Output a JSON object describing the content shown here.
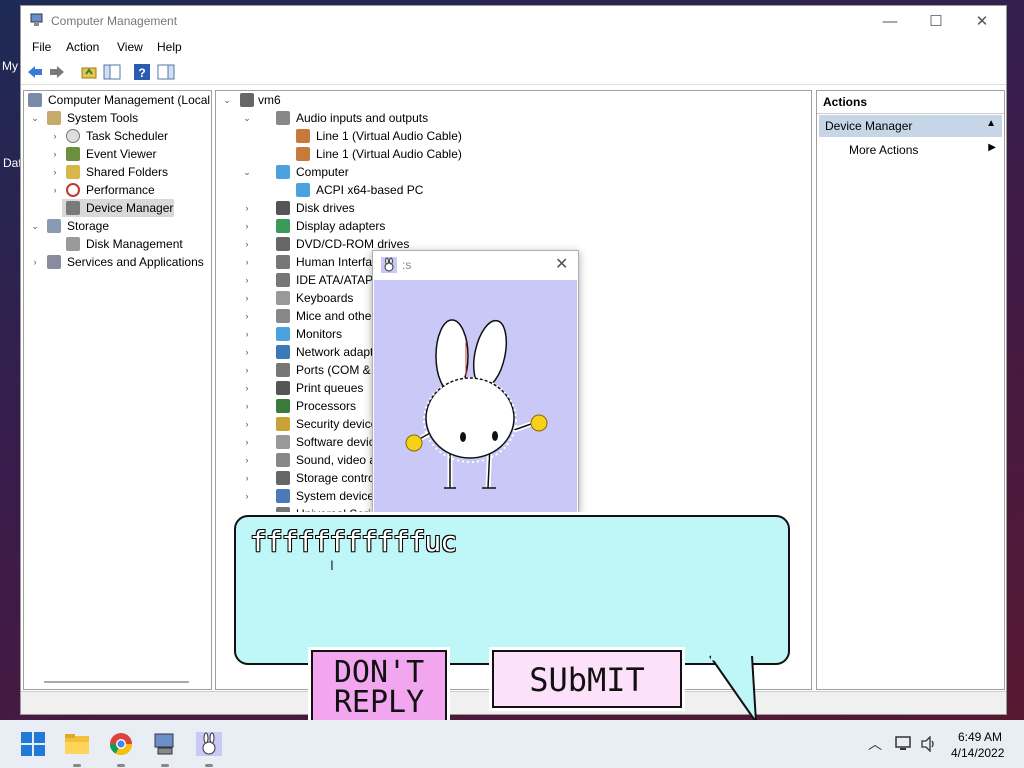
{
  "desktop": {
    "labels": [
      "My",
      "Dat"
    ]
  },
  "window": {
    "title": "Computer Management",
    "controls": {
      "minimize": "—",
      "maximize": "☐",
      "close": "✕"
    }
  },
  "menu": [
    "File",
    "Action",
    "View",
    "Help"
  ],
  "left_tree": {
    "root": "Computer Management (Local",
    "system_tools": "System Tools",
    "task_scheduler": "Task Scheduler",
    "event_viewer": "Event Viewer",
    "shared_folders": "Shared Folders",
    "performance": "Performance",
    "device_manager": "Device Manager",
    "storage": "Storage",
    "disk_management": "Disk Management",
    "services": "Services and Applications"
  },
  "device_tree": {
    "root": "vm6",
    "items": [
      "Audio inputs and outputs",
      "Line 1 (Virtual Audio Cable)",
      "Line 1 (Virtual Audio Cable)",
      "Computer",
      "ACPI x64-based PC",
      "Disk drives",
      "Display adapters",
      "DVD/CD-ROM drives",
      "Human Interface D",
      "IDE ATA/ATAPI cor",
      "Keyboards",
      "Mice and other po",
      "Monitors",
      "Network adapters",
      "Ports (COM & LPT",
      "Print queues",
      "Processors",
      "Security devices",
      "Software devices",
      "Sound, video and",
      "Storage controller",
      "System devices",
      "Universal Serial Bus controllers"
    ]
  },
  "actions": {
    "header": "Actions",
    "section": "Device Manager",
    "more": "More Actions"
  },
  "popup": {
    "title": ":s"
  },
  "bubble": {
    "text": "fffffffffffuc",
    "dont_reply": "DON'T\nREPLY",
    "submit": "SUbMIT"
  },
  "taskbar": {
    "time": "6:49 AM",
    "date": "4/14/2022"
  }
}
